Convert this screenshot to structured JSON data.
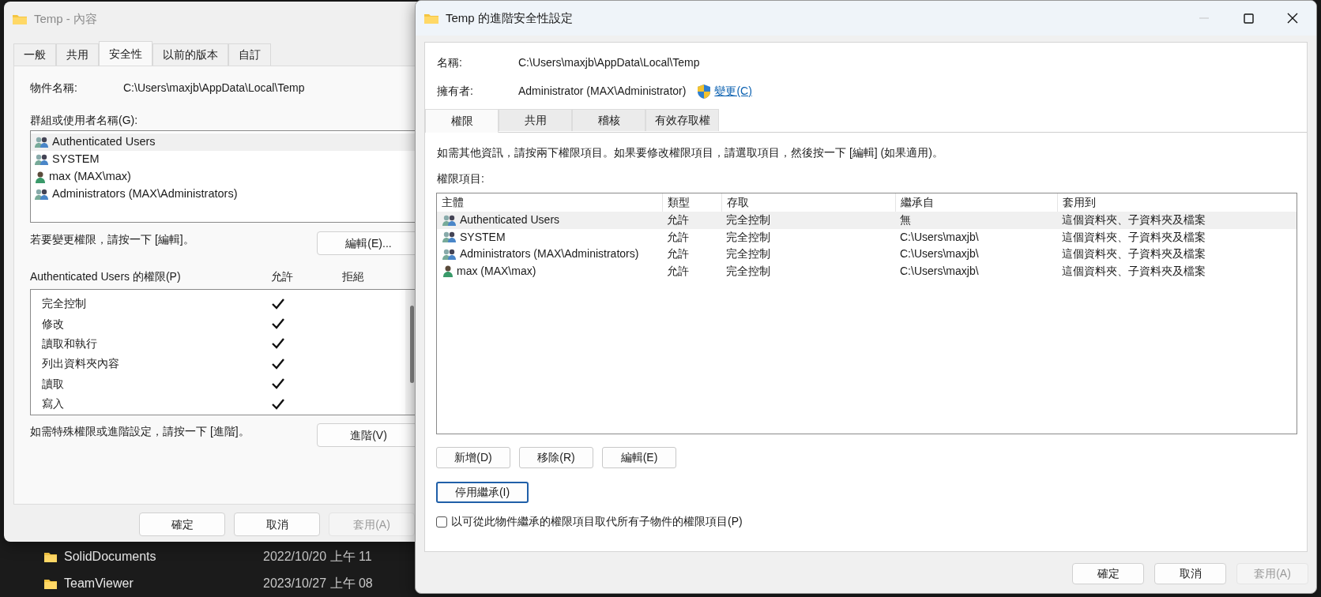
{
  "background_window": {
    "rows": [
      {
        "name": "SolidDocuments",
        "date": "2022/10/20 上午 11"
      },
      {
        "name": "TeamViewer",
        "date": "2023/10/27 上午 08"
      }
    ]
  },
  "properties_dialog": {
    "title": "Temp - 內容",
    "tabs": [
      {
        "label": "一般",
        "selected": false
      },
      {
        "label": "共用",
        "selected": false
      },
      {
        "label": "安全性",
        "selected": true
      },
      {
        "label": "以前的版本",
        "selected": false
      },
      {
        "label": "自訂",
        "selected": false
      }
    ],
    "object_name_label": "物件名稱:",
    "object_name_value": "C:\\Users\\maxjb\\AppData\\Local\\Temp",
    "groups_label": "群組或使用者名稱(G):",
    "groups": [
      {
        "name": "Authenticated Users",
        "kind": "group",
        "selected": true
      },
      {
        "name": "SYSTEM",
        "kind": "group",
        "selected": false
      },
      {
        "name": "max (MAX\\max)",
        "kind": "user",
        "selected": false
      },
      {
        "name": "Administrators (MAX\\Administrators)",
        "kind": "group",
        "selected": false
      }
    ],
    "edit_hint": "若要變更權限，請按一下 [編輯]。",
    "edit_button": "編輯(E)...",
    "permissions_label": "Authenticated Users 的權限(P)",
    "allow_header": "允許",
    "deny_header": "拒絕",
    "permissions": [
      {
        "name": "完全控制",
        "allow": true,
        "deny": false
      },
      {
        "name": "修改",
        "allow": true,
        "deny": false
      },
      {
        "name": "讀取和執行",
        "allow": true,
        "deny": false
      },
      {
        "name": "列出資料夾內容",
        "allow": true,
        "deny": false
      },
      {
        "name": "讀取",
        "allow": true,
        "deny": false
      },
      {
        "name": "寫入",
        "allow": true,
        "deny": false
      }
    ],
    "advanced_hint": "如需特殊權限或進階設定，請按一下 [進階]。",
    "advanced_button": "進階(V)",
    "buttons": [
      {
        "label": "確定",
        "disabled": false
      },
      {
        "label": "取消",
        "disabled": false
      },
      {
        "label": "套用(A)",
        "disabled": true
      }
    ]
  },
  "advanced_window": {
    "title": "Temp 的進階安全性設定",
    "name_label": "名稱:",
    "name_value": "C:\\Users\\maxjb\\AppData\\Local\\Temp",
    "owner_label": "擁有者:",
    "owner_value": "Administrator (MAX\\Administrator)",
    "change_link": "變更(C)",
    "tabs": [
      {
        "label": "權限",
        "selected": true
      },
      {
        "label": "共用",
        "selected": false
      },
      {
        "label": "稽核",
        "selected": false
      },
      {
        "label": "有效存取權",
        "selected": false
      }
    ],
    "info_text": "如需其他資訊，請按兩下權限項目。如果要修改權限項目，請選取項目，然後按一下 [編輯] (如果適用)。",
    "entries_label": "權限項目:",
    "table": {
      "columns": [
        "主體",
        "類型",
        "存取",
        "繼承自",
        "套用到"
      ],
      "rows": [
        {
          "principal": "Authenticated Users",
          "kind": "group",
          "type": "允許",
          "access": "完全控制",
          "inherited_from": "無",
          "applies_to": "這個資料夾、子資料夾及檔案",
          "selected": true
        },
        {
          "principal": "SYSTEM",
          "kind": "group",
          "type": "允許",
          "access": "完全控制",
          "inherited_from": "C:\\Users\\maxjb\\",
          "applies_to": "這個資料夾、子資料夾及檔案",
          "selected": false
        },
        {
          "principal": "Administrators (MAX\\Administrators)",
          "kind": "group",
          "type": "允許",
          "access": "完全控制",
          "inherited_from": "C:\\Users\\maxjb\\",
          "applies_to": "這個資料夾、子資料夾及檔案",
          "selected": false
        },
        {
          "principal": "max (MAX\\max)",
          "kind": "user",
          "type": "允許",
          "access": "完全控制",
          "inherited_from": "C:\\Users\\maxjb\\",
          "applies_to": "這個資料夾、子資料夾及檔案",
          "selected": false
        }
      ]
    },
    "entry_buttons": [
      "新增(D)",
      "移除(R)",
      "編輯(E)"
    ],
    "inheritance_button": "停用繼承(I)",
    "replace_checkbox": {
      "label": "以可從此物件繼承的權限項目取代所有子物件的權限項目(P)",
      "checked": false
    },
    "buttons": [
      {
        "label": "確定",
        "disabled": false
      },
      {
        "label": "取消",
        "disabled": false
      },
      {
        "label": "套用(A)",
        "disabled": true
      }
    ]
  }
}
